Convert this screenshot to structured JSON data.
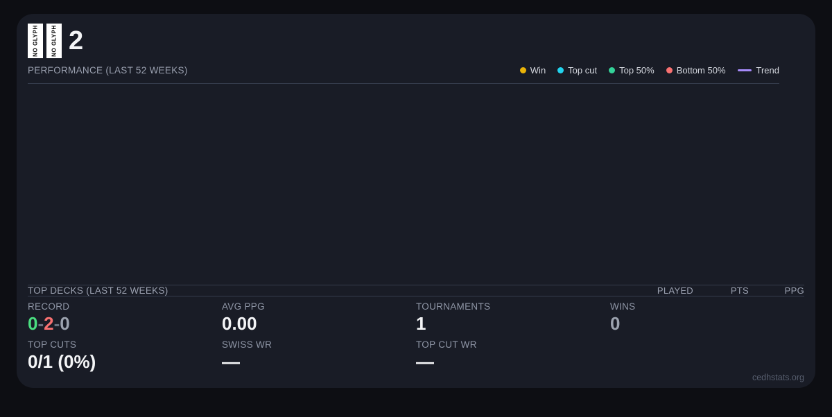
{
  "title": {
    "glyph_placeholder": "NO GLYPH",
    "glyph_count": 2,
    "text": "2"
  },
  "performance": {
    "heading": "PERFORMANCE (LAST 52 WEEKS)",
    "legend": [
      {
        "name": "win",
        "label": "Win",
        "color": "#eab308",
        "swatch": "dot"
      },
      {
        "name": "top-cut",
        "label": "Top cut",
        "color": "#22d3ee",
        "swatch": "dot"
      },
      {
        "name": "top-50",
        "label": "Top 50%",
        "color": "#34d399",
        "swatch": "dot"
      },
      {
        "name": "bottom-50",
        "label": "Bottom 50%",
        "color": "#f87171",
        "swatch": "dot"
      },
      {
        "name": "trend",
        "label": "Trend",
        "color": "#a78bfa",
        "swatch": "line"
      }
    ]
  },
  "chart_data": {
    "type": "scatter",
    "title": "PERFORMANCE (LAST 52 WEEKS)",
    "series": [],
    "x": [],
    "note": "chart plot area is rendered empty - no data points, gridlines, or axis labels visible",
    "legend_position": "top-right",
    "grid": false
  },
  "top_decks": {
    "heading": "TOP DECKS (LAST 52 WEEKS)",
    "columns": [
      "PLAYED",
      "PTS",
      "PPG"
    ],
    "rows": []
  },
  "stats": {
    "record": {
      "label": "RECORD",
      "wins": "0",
      "losses": "2",
      "draws": "0",
      "separator": "-"
    },
    "avg_ppg": {
      "label": "AVG PPG",
      "value": "0.00"
    },
    "tournaments": {
      "label": "TOURNAMENTS",
      "value": "1"
    },
    "wins": {
      "label": "WINS",
      "value": "0"
    },
    "top_cuts": {
      "label": "TOP CUTS",
      "value": "0/1 (0%)"
    },
    "swiss_wr": {
      "label": "SWISS WR",
      "value": "—"
    },
    "top_cut_wr": {
      "label": "TOP CUT WR",
      "value": "—"
    }
  },
  "footer": {
    "watermark": "cedhstats.org"
  }
}
